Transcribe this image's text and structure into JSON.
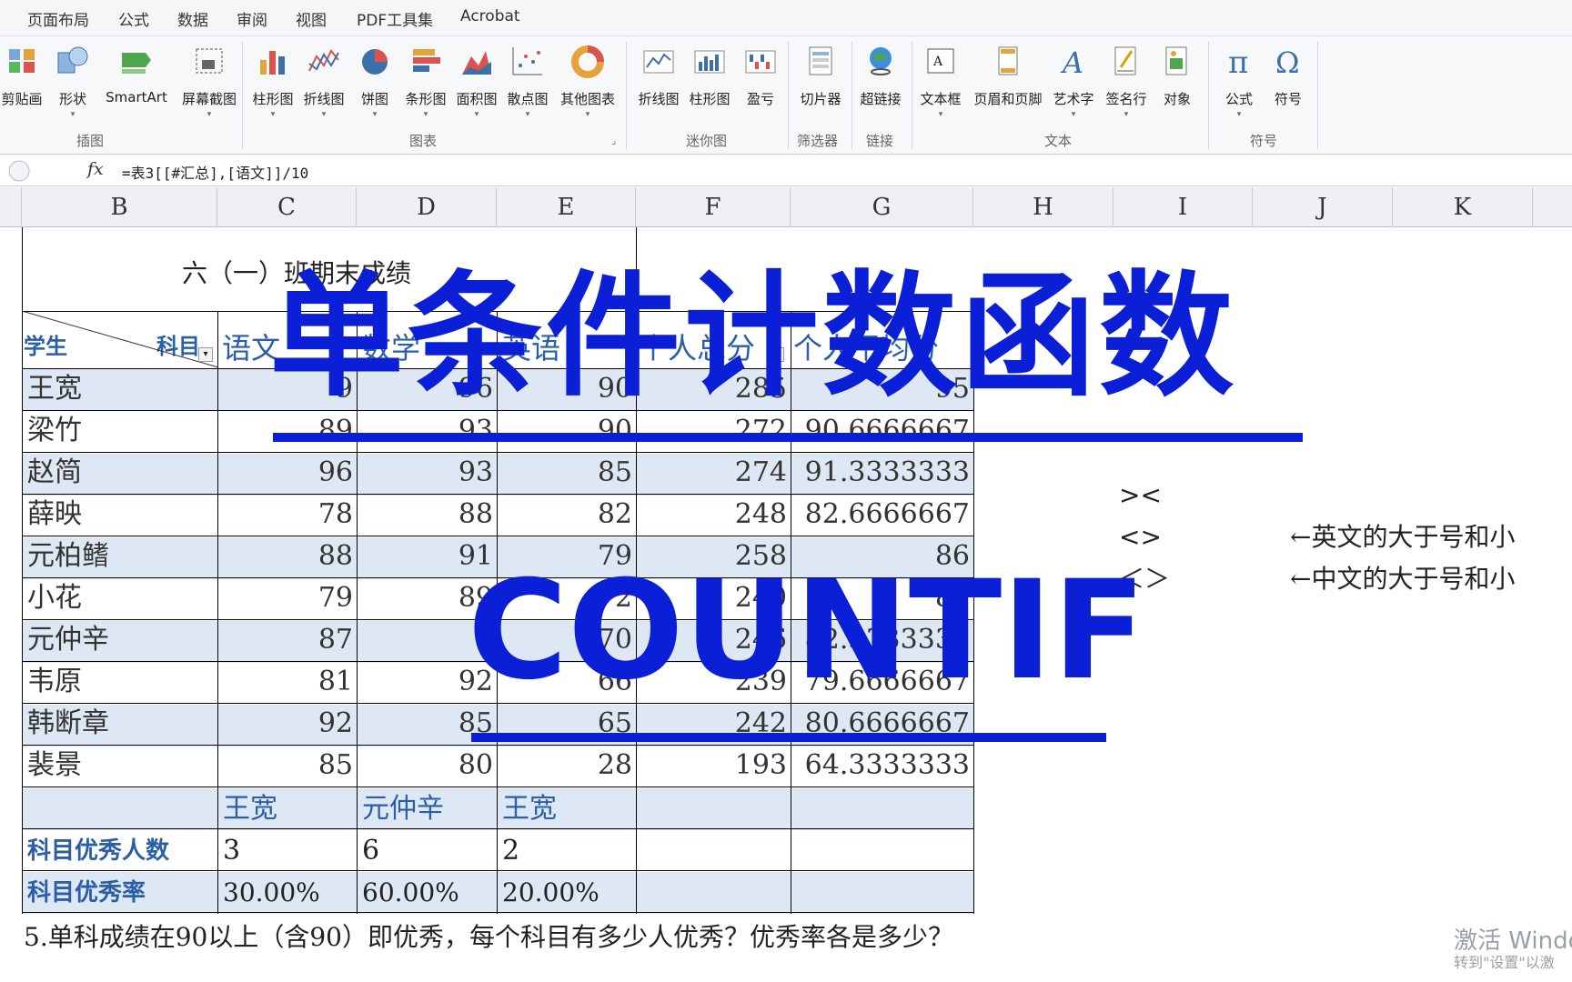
{
  "menu": {
    "tabs": [
      "页面布局",
      "公式",
      "数据",
      "审阅",
      "视图",
      "PDF工具集",
      "Acrobat"
    ]
  },
  "ribbon": {
    "groups": {
      "illustrations": "插图",
      "charts": "图表",
      "sparklines": "迷你图",
      "filter": "筛选器",
      "links": "链接",
      "text": "文本",
      "symbols": "符号"
    },
    "buttons": {
      "clipart": "剪贴画",
      "shapes": "形状",
      "smartart": "SmartArt",
      "screenshot": "屏幕截图",
      "column_chart": "柱形图",
      "line_chart": "折线图",
      "pie_chart": "饼图",
      "bar_chart": "条形图",
      "area_chart": "面积图",
      "scatter_chart": "散点图",
      "other_charts": "其他图表",
      "spark_line": "折线图",
      "spark_column": "柱形图",
      "spark_winloss": "盈亏",
      "slicer": "切片器",
      "hyperlink": "超链接",
      "textbox": "文本框",
      "header_footer": "页眉和页脚",
      "wordart": "艺术字",
      "signature": "签名行",
      "object": "对象",
      "equation": "公式",
      "symbol": "符号"
    }
  },
  "formula_bar": {
    "fx_label": "fx",
    "formula": "=表3[[#汇总],[语文]]/10"
  },
  "columns": [
    "B",
    "C",
    "D",
    "E",
    "F",
    "G",
    "H",
    "I",
    "J",
    "K"
  ],
  "sheet": {
    "title": "六（一）班期末成绩",
    "corner_student": "学生",
    "corner_subject": "科目",
    "headers": [
      "语文",
      "数学",
      "英语",
      "个人总分",
      "个人平均分"
    ],
    "rows": [
      {
        "name": "王宽",
        "chinese": "9",
        "math": "96",
        "english": "90",
        "total": "285",
        "avg": "95"
      },
      {
        "name": "梁竹",
        "chinese": "89",
        "math": "93",
        "english": "90",
        "total": "272",
        "avg": "90.6666667"
      },
      {
        "name": "赵简",
        "chinese": "96",
        "math": "93",
        "english": "85",
        "total": "274",
        "avg": "91.3333333"
      },
      {
        "name": "薛映",
        "chinese": "78",
        "math": "88",
        "english": "82",
        "total": "248",
        "avg": "82.6666667"
      },
      {
        "name": "元柏鳍",
        "chinese": "88",
        "math": "91",
        "english": "79",
        "total": "258",
        "avg": "86"
      },
      {
        "name": "小花",
        "chinese": "79",
        "math": "89",
        "english": "72",
        "total": "240",
        "avg": "80"
      },
      {
        "name": "元仲辛",
        "chinese": "87",
        "math": "9",
        "english": "70",
        "total": "246",
        "avg": "82.3333333"
      },
      {
        "name": "韦原",
        "chinese": "81",
        "math": "92",
        "english": "66",
        "total": "239",
        "avg": "79.6666667"
      },
      {
        "name": "韩断章",
        "chinese": "92",
        "math": "85",
        "english": "65",
        "total": "242",
        "avg": "80.6666667"
      },
      {
        "name": "裴景",
        "chinese": "85",
        "math": "80",
        "english": "28",
        "total": "193",
        "avg": "64.3333333"
      }
    ],
    "top_row": [
      "王宽",
      "元仲辛",
      "王宽"
    ],
    "excellent_count_label": "科目优秀人数",
    "excellent_count": [
      "3",
      "6",
      "2"
    ],
    "excellent_rate_label": "科目优秀率",
    "excellent_rate": [
      "30.00%",
      "60.00%",
      "20.00%"
    ],
    "question": "5.单科成绩在90以上（含90）即优秀，每个科目有多少人优秀？优秀率各是多少？"
  },
  "notes": {
    "sym1": "><",
    "sym2": "<>",
    "sym3": "＜＞",
    "note1": "←英文的大于号和小",
    "note2": "←中文的大于号和小"
  },
  "overlay": {
    "title": "单条件计数函数",
    "function": "COUNTIF"
  },
  "watermark": {
    "line1": "激活 Windo",
    "line2": "转到\"设置\"以激"
  },
  "colors": {
    "overlay_blue": "#0a1fd6",
    "table_header_blue": "#2a5fa8",
    "band_fill": "#dde8f4"
  }
}
